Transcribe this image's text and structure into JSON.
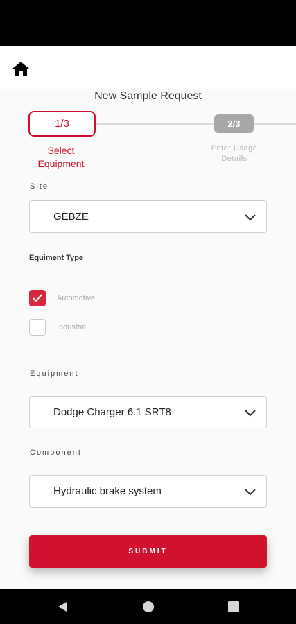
{
  "header": {
    "home_icon": "home-icon"
  },
  "page": {
    "title": "New Sample Request"
  },
  "stepper": {
    "steps": [
      {
        "badge": "1/3",
        "label_line1": "Select",
        "label_line2": "Equipment",
        "state": "active"
      },
      {
        "badge": "2/3",
        "label_line1": "Enter Usage",
        "label_line2": "Details",
        "state": "inactive"
      }
    ]
  },
  "form": {
    "site": {
      "label": "Site",
      "value": "GEBZE"
    },
    "equipment_type": {
      "label": "Equiment Type",
      "options": [
        {
          "label": "Automotive",
          "checked": true
        },
        {
          "label": "Industrial",
          "checked": false
        }
      ]
    },
    "equipment": {
      "label": "Equipment",
      "value": "Dodge Charger 6.1 SRT8"
    },
    "component": {
      "label": "Component",
      "value": "Hydraulic brake system"
    },
    "submit_label": "SUBMIT"
  },
  "nav": {
    "back_icon": "back-triangle-icon",
    "home_icon": "home-circle-icon",
    "recents_icon": "recents-square-icon"
  },
  "colors": {
    "accent": "#d0112b",
    "inactive_step": "#a8a8a8",
    "background": "#fafafa"
  }
}
